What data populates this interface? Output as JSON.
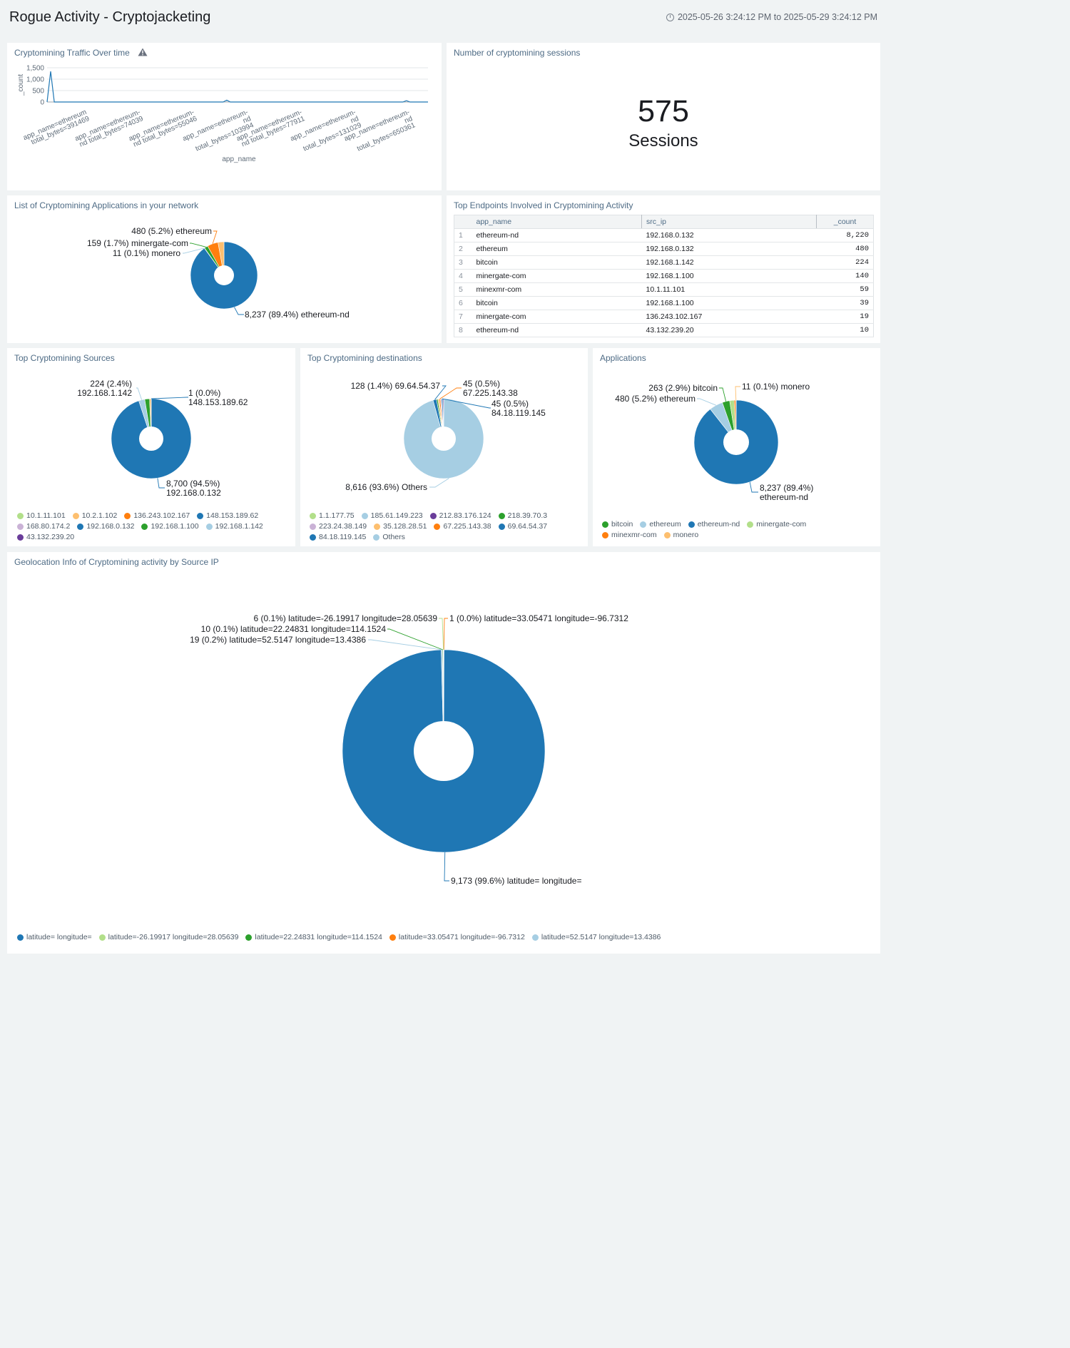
{
  "header": {
    "title": "Rogue Activity - Cryptojacketing",
    "time_range": "2025-05-26 3:24:12 PM to 2025-05-29 3:24:12 PM"
  },
  "colors": {
    "blue": "#1f77b4",
    "light_blue": "#a6cee3",
    "orange": "#ff7f0e",
    "light_orange": "#fdbf6f",
    "green": "#2ca02c",
    "light_green": "#b2df8a",
    "purple": "#6a3d9a",
    "lavender": "#cab2d6",
    "title_text": "#4e6b85"
  },
  "panels": {
    "traffic": {
      "title": "Cryptomining Traffic Over time",
      "warning_icon": "warning-icon"
    },
    "sessions": {
      "title": "Number of cryptomining sessions",
      "value": "575",
      "unit": "Sessions"
    },
    "apps_list": {
      "title": "List of Cryptomining Applications in your network"
    },
    "endpoints": {
      "title": "Top Endpoints Involved in Cryptomining Activity",
      "columns": [
        "app_name",
        "src_ip",
        "_count"
      ],
      "rows": [
        [
          "1",
          "ethereum-nd",
          "192.168.0.132",
          "8,220"
        ],
        [
          "2",
          "ethereum",
          "192.168.0.132",
          "480"
        ],
        [
          "3",
          "bitcoin",
          "192.168.1.142",
          "224"
        ],
        [
          "4",
          "minergate-com",
          "192.168.1.100",
          "140"
        ],
        [
          "5",
          "minexmr-com",
          "10.1.11.101",
          "59"
        ],
        [
          "6",
          "bitcoin",
          "192.168.1.100",
          "39"
        ],
        [
          "7",
          "minergate-com",
          "136.243.102.167",
          "19"
        ],
        [
          "8",
          "ethereum-nd",
          "43.132.239.20",
          "10"
        ]
      ]
    },
    "sources": {
      "title": "Top Cryptomining Sources"
    },
    "destinations": {
      "title": "Top Cryptomining destinations"
    },
    "applications": {
      "title": "Applications"
    },
    "geo": {
      "title": "Geolocation Info of Cryptomining activity by Source IP"
    }
  },
  "chart_data": [
    {
      "id": "traffic",
      "type": "line",
      "xlabel": "app_name",
      "ylabel": "_count",
      "ylim": [
        0,
        1500
      ],
      "yticks": [
        "0",
        "500",
        "1,000",
        "1,500"
      ],
      "grid": true,
      "x_tick_labels": [
        [
          "app_name=ethereum",
          "total_bytes=391469"
        ],
        [
          "app_name=ethereum-",
          "nd total_bytes=74039"
        ],
        [
          "app_name=ethereum-",
          "nd total_bytes=55046"
        ],
        [
          "app_name=ethereum-",
          "nd",
          "total_bytes=103994"
        ],
        [
          "app_name=ethereum-",
          "nd total_bytes=77911"
        ],
        [
          "app_name=ethereum-",
          "nd",
          "total_bytes=131029"
        ],
        [
          "app_name=ethereum-",
          "nd",
          "total_bytes=650361"
        ]
      ],
      "series": [
        {
          "values": [
            0,
            1340,
            0,
            0,
            0,
            0,
            0,
            0,
            0,
            0,
            0,
            0,
            0,
            0,
            0,
            0,
            0,
            0,
            0,
            0,
            0,
            0,
            0,
            0,
            0,
            0,
            0,
            0,
            0,
            0,
            0,
            0,
            0,
            0,
            0,
            0,
            0,
            0,
            0,
            0,
            0,
            0,
            0,
            0,
            0,
            0,
            0,
            0,
            0,
            0,
            80,
            0,
            0,
            0,
            0,
            0,
            0,
            0,
            0,
            0,
            0,
            0,
            0,
            0,
            0,
            0,
            0,
            0,
            0,
            0,
            0,
            0,
            0,
            0,
            0,
            0,
            0,
            0,
            0,
            0,
            0,
            0,
            0,
            0,
            0,
            0,
            0,
            0,
            0,
            0,
            0,
            0,
            0,
            0,
            0,
            0,
            0,
            0,
            0,
            0,
            60,
            0,
            0,
            0,
            0,
            0,
            0
          ]
        }
      ]
    },
    {
      "id": "apps_list",
      "type": "pie",
      "slices": [
        {
          "label": "ethereum-nd",
          "value": 8237,
          "text": "8,237 (89.4%) ethereum-nd",
          "color": "#1f77b4"
        },
        {
          "label": "monero",
          "value": 11,
          "text": "11 (0.1%) monero",
          "color": "#a6cee3"
        },
        {
          "label": "minergate-com",
          "value": 159,
          "text": "159 (1.7%) minergate-com",
          "color": "#2ca02c"
        },
        {
          "label": "ethereum",
          "value": 480,
          "text": "480 (5.2%) ethereum",
          "color": "#ff7f0e"
        },
        {
          "label": "bitcoin",
          "value": 263,
          "text": "",
          "color": "#fdbf6f"
        }
      ]
    },
    {
      "id": "sources",
      "type": "pie",
      "slices": [
        {
          "label": "192.168.0.132",
          "value": 8700,
          "text": "8,700 (94.5%)|192.168.0.132",
          "color": "#1f77b4"
        },
        {
          "label": "192.168.1.142",
          "value": 224,
          "text": "224 (2.4%)|192.168.1.142",
          "color": "#a6cee3"
        },
        {
          "label": "192.168.1.100",
          "value": 179,
          "text": "",
          "color": "#2ca02c"
        },
        {
          "label": "10.2.1.102",
          "value": 59,
          "text": "",
          "color": "#fdbf6f"
        },
        {
          "label": "148.153.189.62",
          "value": 1,
          "text": "1 (0.0%)|148.153.189.62",
          "color": "#1f77b4"
        }
      ],
      "legend": [
        {
          "label": "10.1.11.101",
          "color": "#b2df8a"
        },
        {
          "label": "10.2.1.102",
          "color": "#fdbf6f"
        },
        {
          "label": "136.243.102.167",
          "color": "#ff7f0e"
        },
        {
          "label": "148.153.189.62",
          "color": "#1f77b4"
        },
        {
          "label": "168.80.174.2",
          "color": "#cab2d6"
        },
        {
          "label": "192.168.0.132",
          "color": "#1f77b4"
        },
        {
          "label": "192.168.1.100",
          "color": "#2ca02c"
        },
        {
          "label": "192.168.1.142",
          "color": "#a6cee3"
        },
        {
          "label": "43.132.239.20",
          "color": "#6a3d9a"
        }
      ]
    },
    {
      "id": "destinations",
      "type": "pie",
      "slices": [
        {
          "label": "Others",
          "value": 8616,
          "text": "8,616 (93.6%) Others",
          "color": "#a6cee3"
        },
        {
          "label": "69.64.54.37",
          "value": 128,
          "text": "128 (1.4%) 69.64.54.37",
          "color": "#1f77b4"
        },
        {
          "label": "218.39.70.3",
          "value": 50,
          "text": "",
          "color": "#2ca02c"
        },
        {
          "label": "35.128.28.51",
          "value": 50,
          "text": "",
          "color": "#fdbf6f"
        },
        {
          "label": "67.225.143.38",
          "value": 45,
          "text": "45 (0.5%)|67.225.143.38",
          "color": "#ff7f0e"
        },
        {
          "label": "223.24.38.149",
          "value": 40,
          "text": "",
          "color": "#cab2d6"
        },
        {
          "label": "84.18.119.145",
          "value": 45,
          "text": "45 (0.5%)|84.18.119.145",
          "color": "#1f77b4"
        },
        {
          "label": "212.83.176.124",
          "value": 30,
          "text": "",
          "color": "#6a3d9a"
        }
      ],
      "legend": [
        {
          "label": "1.1.177.75",
          "color": "#b2df8a"
        },
        {
          "label": "185.61.149.223",
          "color": "#a6cee3"
        },
        {
          "label": "212.83.176.124",
          "color": "#6a3d9a"
        },
        {
          "label": "218.39.70.3",
          "color": "#2ca02c"
        },
        {
          "label": "223.24.38.149",
          "color": "#cab2d6"
        },
        {
          "label": "35.128.28.51",
          "color": "#fdbf6f"
        },
        {
          "label": "67.225.143.38",
          "color": "#ff7f0e"
        },
        {
          "label": "69.64.54.37",
          "color": "#1f77b4"
        },
        {
          "label": "84.18.119.145",
          "color": "#1f77b4"
        },
        {
          "label": "Others",
          "color": "#a6cee3"
        }
      ]
    },
    {
      "id": "applications",
      "type": "pie",
      "slices": [
        {
          "label": "ethereum-nd",
          "value": 8237,
          "text": "8,237 (89.4%)|ethereum-nd",
          "color": "#1f77b4"
        },
        {
          "label": "ethereum",
          "value": 480,
          "text": "480 (5.2%) ethereum",
          "color": "#a6cee3"
        },
        {
          "label": "bitcoin",
          "value": 263,
          "text": "263 (2.9%) bitcoin",
          "color": "#2ca02c"
        },
        {
          "label": "minergate-com",
          "value": 159,
          "text": "",
          "color": "#b2df8a"
        },
        {
          "label": "minexmr-com",
          "value": 59,
          "text": "",
          "color": "#ff7f0e"
        },
        {
          "label": "monero",
          "value": 11,
          "text": "11 (0.1%) monero",
          "color": "#fdbf6f"
        }
      ],
      "legend": [
        {
          "label": "bitcoin",
          "color": "#2ca02c"
        },
        {
          "label": "ethereum",
          "color": "#a6cee3"
        },
        {
          "label": "ethereum-nd",
          "color": "#1f77b4"
        },
        {
          "label": "minergate-com",
          "color": "#b2df8a"
        },
        {
          "label": "minexmr-com",
          "color": "#ff7f0e"
        },
        {
          "label": "monero",
          "color": "#fdbf6f"
        }
      ]
    },
    {
      "id": "geo",
      "type": "pie",
      "slices": [
        {
          "label": "latitude= longitude=",
          "value": 9173,
          "text": "9,173 (99.6%) latitude= longitude=",
          "color": "#1f77b4"
        },
        {
          "label": "latitude=52.5147 longitude=13.4386",
          "value": 19,
          "text": "19 (0.2%) latitude=52.5147 longitude=13.4386",
          "color": "#a6cee3"
        },
        {
          "label": "latitude=22.24831 longitude=114.1524",
          "value": 10,
          "text": "10 (0.1%) latitude=22.24831 longitude=114.1524",
          "color": "#2ca02c"
        },
        {
          "label": "latitude=-26.19917 longitude=28.05639",
          "value": 6,
          "text": "6 (0.1%) latitude=-26.19917 longitude=28.05639",
          "color": "#b2df8a"
        },
        {
          "label": "latitude=33.05471 longitude=-96.7312",
          "value": 1,
          "text": "1 (0.0%) latitude=33.05471 longitude=-96.7312",
          "color": "#ff7f0e"
        }
      ],
      "legend": [
        {
          "label": "latitude= longitude=",
          "color": "#1f77b4"
        },
        {
          "label": "latitude=-26.19917 longitude=28.05639",
          "color": "#b2df8a"
        },
        {
          "label": "latitude=22.24831 longitude=114.1524",
          "color": "#2ca02c"
        },
        {
          "label": "latitude=33.05471 longitude=-96.7312",
          "color": "#ff7f0e"
        },
        {
          "label": "latitude=52.5147 longitude=13.4386",
          "color": "#a6cee3"
        }
      ]
    }
  ]
}
